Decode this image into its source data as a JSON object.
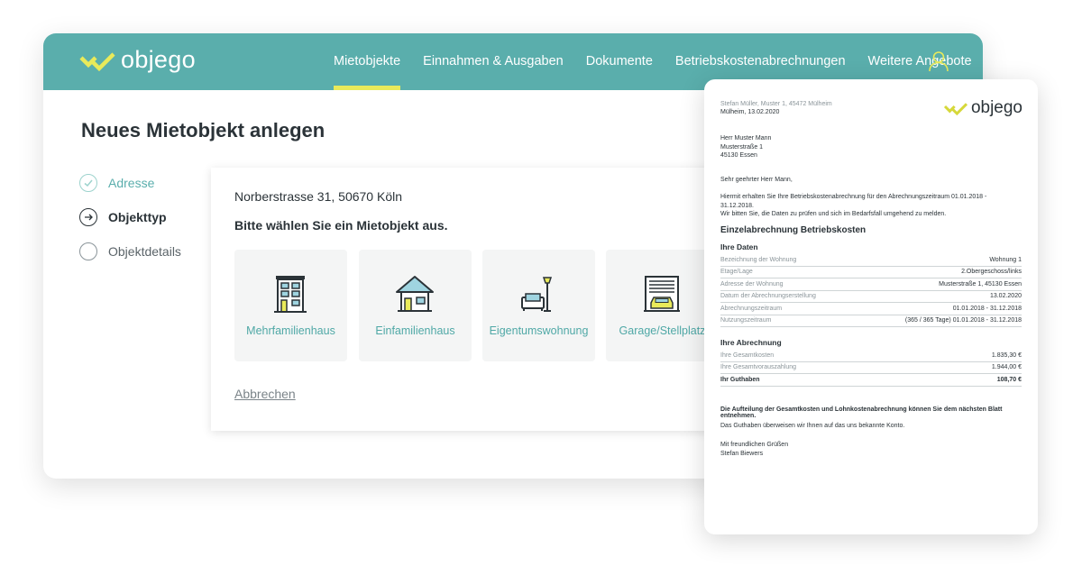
{
  "app": {
    "brand": "objego",
    "nav": [
      "Mietobjekte",
      "Einnahmen & Ausgaben",
      "Dokumente",
      "Betriebskostenabrechnungen",
      "Weitere Angebote"
    ],
    "active_nav": "Mietobjekte",
    "page_title": "Neues Mietobjekt anlegen",
    "steps": [
      {
        "label": "Adresse",
        "state": "done"
      },
      {
        "label": "Objekttyp",
        "state": "current"
      },
      {
        "label": "Objektdetails",
        "state": "pending"
      }
    ],
    "address": "Norberstrasse 31, 50670 Köln",
    "prompt": "Bitte wählen Sie ein Mietobjekt aus.",
    "tiles": [
      {
        "label": "Mehrfamilienhaus",
        "icon": "apartment-building-icon"
      },
      {
        "label": "Einfamilienhaus",
        "icon": "house-icon"
      },
      {
        "label": "Eigentumswohnung",
        "icon": "sofa-lamp-icon"
      },
      {
        "label": "Garage/Stellplatz",
        "icon": "garage-icon"
      }
    ],
    "cancel_label": "Abbrechen",
    "colors": {
      "header": "#5aaeac",
      "accent": "#e9ea5a",
      "logo_yellow": "#d6d83a",
      "link": "#4fa8a6"
    }
  },
  "document": {
    "sender_line": "Stefan  Müller,   Muster 1, 45472 Mülheim",
    "place_date": "Mülheim, 13.02.2020",
    "logo": "objego",
    "recipient": [
      "Herr Muster Mann",
      "Musterstraße 1",
      "45130 Essen"
    ],
    "salutation": "Sehr geehrter Herr Mann,",
    "intro": [
      "Hiermit erhalten Sie Ihre Betriebskostenabrechnung für den Abrechnungszeitraum 01.01.2018 - 31.12.2018.",
      "Wir bitten Sie, die Daten zu prüfen und sich im Bedarfsfall umgehend zu melden."
    ],
    "heading": "Einzelabrechnung Betriebskosten",
    "your_data_title": "Ihre Daten",
    "your_data": [
      {
        "label": "Bezeichnung der Wohnung",
        "value": "Wohnung 1"
      },
      {
        "label": "Etage/Lage",
        "value": "2.Obergeschoss/links"
      },
      {
        "label": "Adresse der Wohnung",
        "value": "Musterstraße 1, 45130 Essen"
      },
      {
        "label": "Datum der Abrechnungserstellung",
        "value": "13.02.2020"
      },
      {
        "label": "Abrechnungszeitraum",
        "value": "01.01.2018 - 31.12.2018"
      },
      {
        "label": "Nutzungszeitraum",
        "value": "(365 / 365 Tage)  01.01.2018 - 31.12.2018"
      }
    ],
    "billing_title": "Ihre Abrechnung",
    "billing": [
      {
        "label": "Ihre Gesamtkosten",
        "value": "1.835,30 €"
      },
      {
        "label": "Ihre Gesamtvorauszahlung",
        "value": "1.944,00 €"
      },
      {
        "label": "Ihr Guthaben",
        "value": "108,70 €"
      }
    ],
    "note_bold": "Die Aufteilung der Gesamtkosten und Lohnkostenabrechnung können Sie dem nächsten Blatt entnehmen.",
    "note": "Das Guthaben überweisen wir Ihnen auf das uns bekannte Konto.",
    "closing": [
      "Mit freundlichen Grüßen",
      "Stefan Biewers"
    ]
  }
}
